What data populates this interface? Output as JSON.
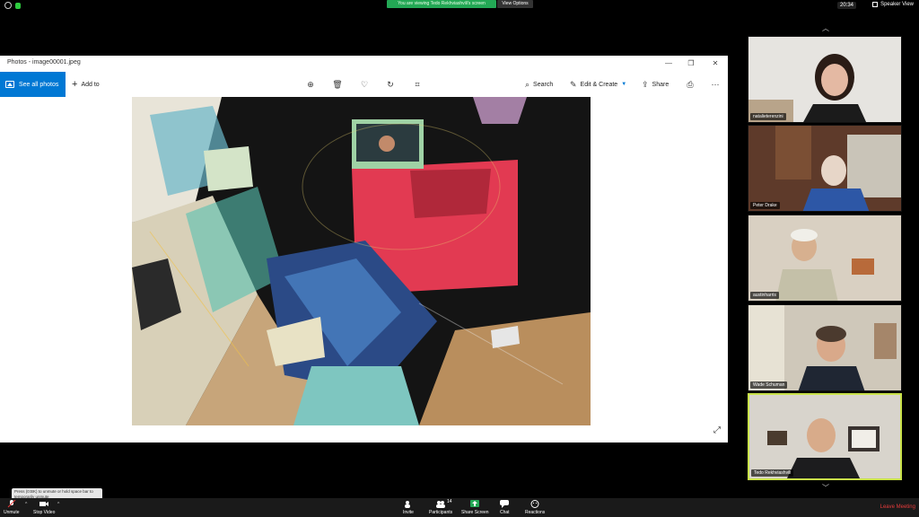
{
  "topbar": {
    "share_banner": "You are viewing Tedo Rekhviashvili's screen",
    "view_options": "View Options",
    "time": "20:34",
    "speaker_view": "Speaker View"
  },
  "photos_window": {
    "title": "Photos - image00001.jpeg",
    "see_all": "See all photos",
    "add_to": "Add to",
    "search": "Search",
    "edit_create": "Edit & Create",
    "share": "Share"
  },
  "participants": [
    {
      "name": "natalieterenzini"
    },
    {
      "name": "Peter Drake"
    },
    {
      "name": "austinharris"
    },
    {
      "name": "Wade Schuman"
    },
    {
      "name": "Tedo Rekhviashvili",
      "active": true
    }
  ],
  "bottombar": {
    "unmute": "Unmute",
    "stop_video": "Stop Video",
    "invite": "Invite",
    "participants": "Participants",
    "participants_count": "14",
    "share_screen": "Share Screen",
    "chat": "Chat",
    "reactions": "Reactions",
    "leave": "Leave Meeting"
  },
  "tooltip": "Press (0:BK) to unmute or hold space bar to temporarily unmute",
  "colors": {
    "share_green": "#23a855",
    "photos_blue": "#0078d4",
    "active_speaker": "#c9e24a",
    "leave_red": "#e63b3b"
  }
}
